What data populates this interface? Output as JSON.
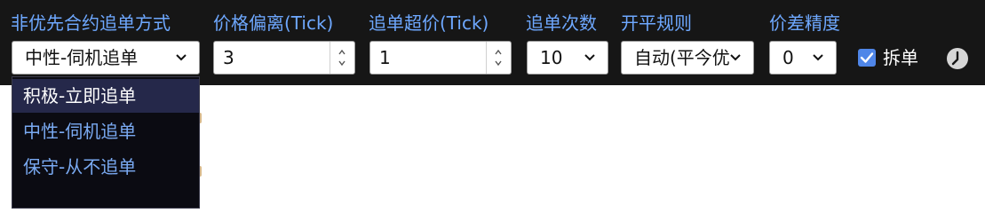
{
  "labels": {
    "chase_mode": "非优先合约追单方式",
    "price_offset": "价格偏离(Tick)",
    "chase_over_price": "追单超价(Tick)",
    "chase_count": "追单次数",
    "open_close_rule": "开平规则",
    "price_precision": "价差精度"
  },
  "controls": {
    "chase_mode_value": "中性-伺机追单",
    "price_offset_value": "3",
    "chase_over_price_value": "1",
    "chase_count_value": "10",
    "open_close_rule_value": "自动(平今优",
    "price_precision_value": "0"
  },
  "split_order": {
    "label": "拆单",
    "checked": true
  },
  "dropdown": {
    "options": [
      {
        "label": "积极-立即追单",
        "highlighted": true
      },
      {
        "label": "中性-伺机追单",
        "highlighted": false
      },
      {
        "label": "保守-从不追单",
        "highlighted": false
      }
    ]
  },
  "icons": {
    "chevron": "chevron-down-icon",
    "spin_up": "caret-up-icon",
    "spin_down": "caret-down-icon",
    "check": "checkmark-icon",
    "clock": "clock-icon"
  },
  "colors": {
    "toolbar_bg": "#161616",
    "label": "#6ea8ff",
    "dropdown_bg": "#0b0b12",
    "dropdown_highlight": "#25284a",
    "dropdown_text": "#7aaaf2",
    "checkbox": "#4f86e8"
  }
}
